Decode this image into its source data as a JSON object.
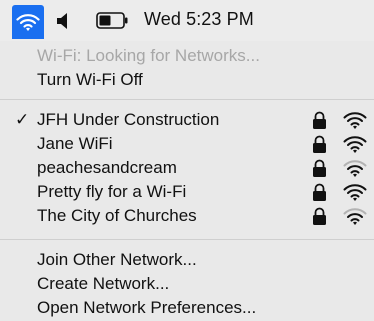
{
  "menubar": {
    "clock": "Wed 5:23 PM",
    "wifi_icon": "wifi-icon",
    "speaker_icon": "speaker-icon",
    "battery_icon": "battery-icon"
  },
  "menu": {
    "status": "Wi-Fi: Looking for Networks...",
    "turn_off": "Turn Wi-Fi Off",
    "networks": [
      {
        "name": "JFH Under Construction",
        "selected": true,
        "locked": true,
        "signal": 3
      },
      {
        "name": "Jane WiFi",
        "selected": false,
        "locked": true,
        "signal": 3
      },
      {
        "name": "peachesandcream",
        "selected": false,
        "locked": true,
        "signal": 2
      },
      {
        "name": "Pretty fly for a Wi-Fi",
        "selected": false,
        "locked": true,
        "signal": 3
      },
      {
        "name": "The City of Churches",
        "selected": false,
        "locked": true,
        "signal": 2
      }
    ],
    "checkmark": "✓",
    "join_other": "Join Other Network...",
    "create_network": "Create Network...",
    "open_prefs": "Open Network Preferences..."
  },
  "colors": {
    "accent": "#1a6ff0",
    "menu_bg": "#e9e9e9",
    "disabled_text": "#a7a7a7"
  }
}
